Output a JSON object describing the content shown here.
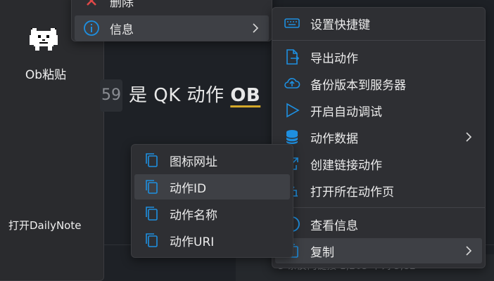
{
  "left_panel": {
    "app_label": "Ob粘贴",
    "daily_label": "打开DailyNote",
    "app_icon": "dog-icon"
  },
  "heading": {
    "number": "59",
    "text": "是 QK 动作 ",
    "highlight": "OB"
  },
  "status": {
    "text": "3 条反向链接   1,205 个词 3,82"
  },
  "menu_top": {
    "items": [
      {
        "label": "删除",
        "icon": "x-icon"
      },
      {
        "label": "信息",
        "icon": "info-icon"
      }
    ]
  },
  "menu_right": {
    "items": [
      {
        "label": "设置快捷键",
        "icon": "keyboard-icon"
      },
      {
        "label": "导出动作",
        "icon": "export-file-icon"
      },
      {
        "label": "备份版本到服务器",
        "icon": "cloud-upload-icon"
      },
      {
        "label": "开启自动调试",
        "icon": "play-icon"
      },
      {
        "label": "动作数据",
        "icon": "database-icon"
      },
      {
        "label": "创建链接动作",
        "icon": "external-link-icon"
      },
      {
        "label": "打开所在动作页",
        "icon": "open-page-icon"
      },
      {
        "label": "查看信息",
        "icon": "info-circle-icon"
      },
      {
        "label": "复制",
        "icon": "copy-icon"
      }
    ]
  },
  "menu_copy": {
    "items": [
      {
        "label": "图标网址",
        "icon": "copy-icon"
      },
      {
        "label": "动作ID",
        "icon": "copy-icon"
      },
      {
        "label": "动作名称",
        "icon": "copy-icon"
      },
      {
        "label": "动作URI",
        "icon": "copy-icon"
      }
    ]
  },
  "colors": {
    "accent_blue": "#1e8fe0",
    "menu_bg": "#2e2f33",
    "highlight_bg": "#3e4045",
    "underline_gold": "#d4a82a"
  }
}
